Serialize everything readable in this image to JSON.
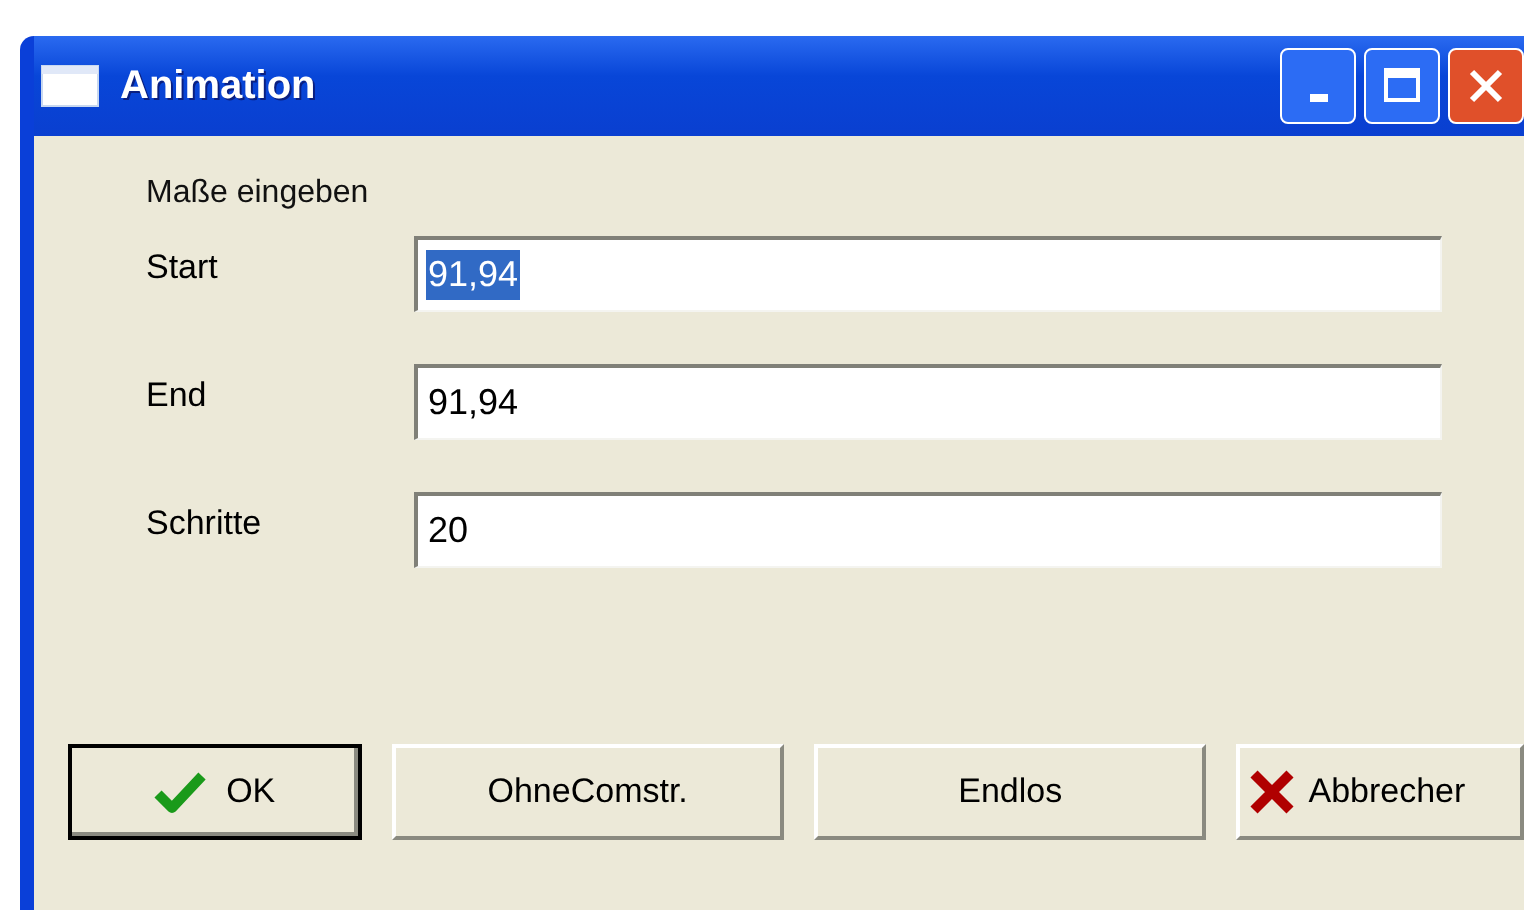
{
  "window": {
    "title": "Animation"
  },
  "heading": "Maße eingeben",
  "fields": [
    {
      "label": "Start",
      "value": "91,94",
      "selected": true
    },
    {
      "label": "End",
      "value": "91,94",
      "selected": false
    },
    {
      "label": "Schritte",
      "value": "20",
      "selected": false
    }
  ],
  "buttons": [
    {
      "label": "OK",
      "kind": "confirm",
      "default": true
    },
    {
      "label": "OhneComstr.",
      "default": false
    },
    {
      "label": "Endlos",
      "default": false
    },
    {
      "label": "Abbrecher",
      "kind": "cancel",
      "default": false
    }
  ]
}
